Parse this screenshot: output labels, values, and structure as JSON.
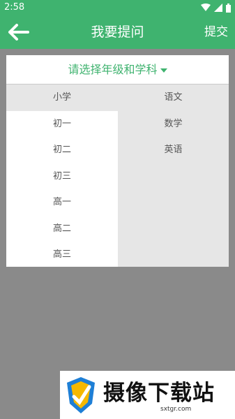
{
  "status_bar": {
    "time": "2:58"
  },
  "app_bar": {
    "title": "我要提问",
    "submit_label": "提交"
  },
  "selector": {
    "label": "请选择年级和学科"
  },
  "grades": [
    {
      "label": "小学",
      "selected": true
    },
    {
      "label": "初一",
      "selected": false
    },
    {
      "label": "初二",
      "selected": false
    },
    {
      "label": "初三",
      "selected": false
    },
    {
      "label": "高一",
      "selected": false
    },
    {
      "label": "高二",
      "selected": false
    },
    {
      "label": "高三",
      "selected": false
    }
  ],
  "subjects": [
    {
      "label": "语文"
    },
    {
      "label": "数学"
    },
    {
      "label": "英语"
    }
  ],
  "watermark": {
    "title": "摄像下载站",
    "subtitle": "sxtgr.com"
  },
  "colors": {
    "primary": "#3fb36f",
    "overlay": "#8a8a8a",
    "selected_bg": "#e6e6e6"
  }
}
